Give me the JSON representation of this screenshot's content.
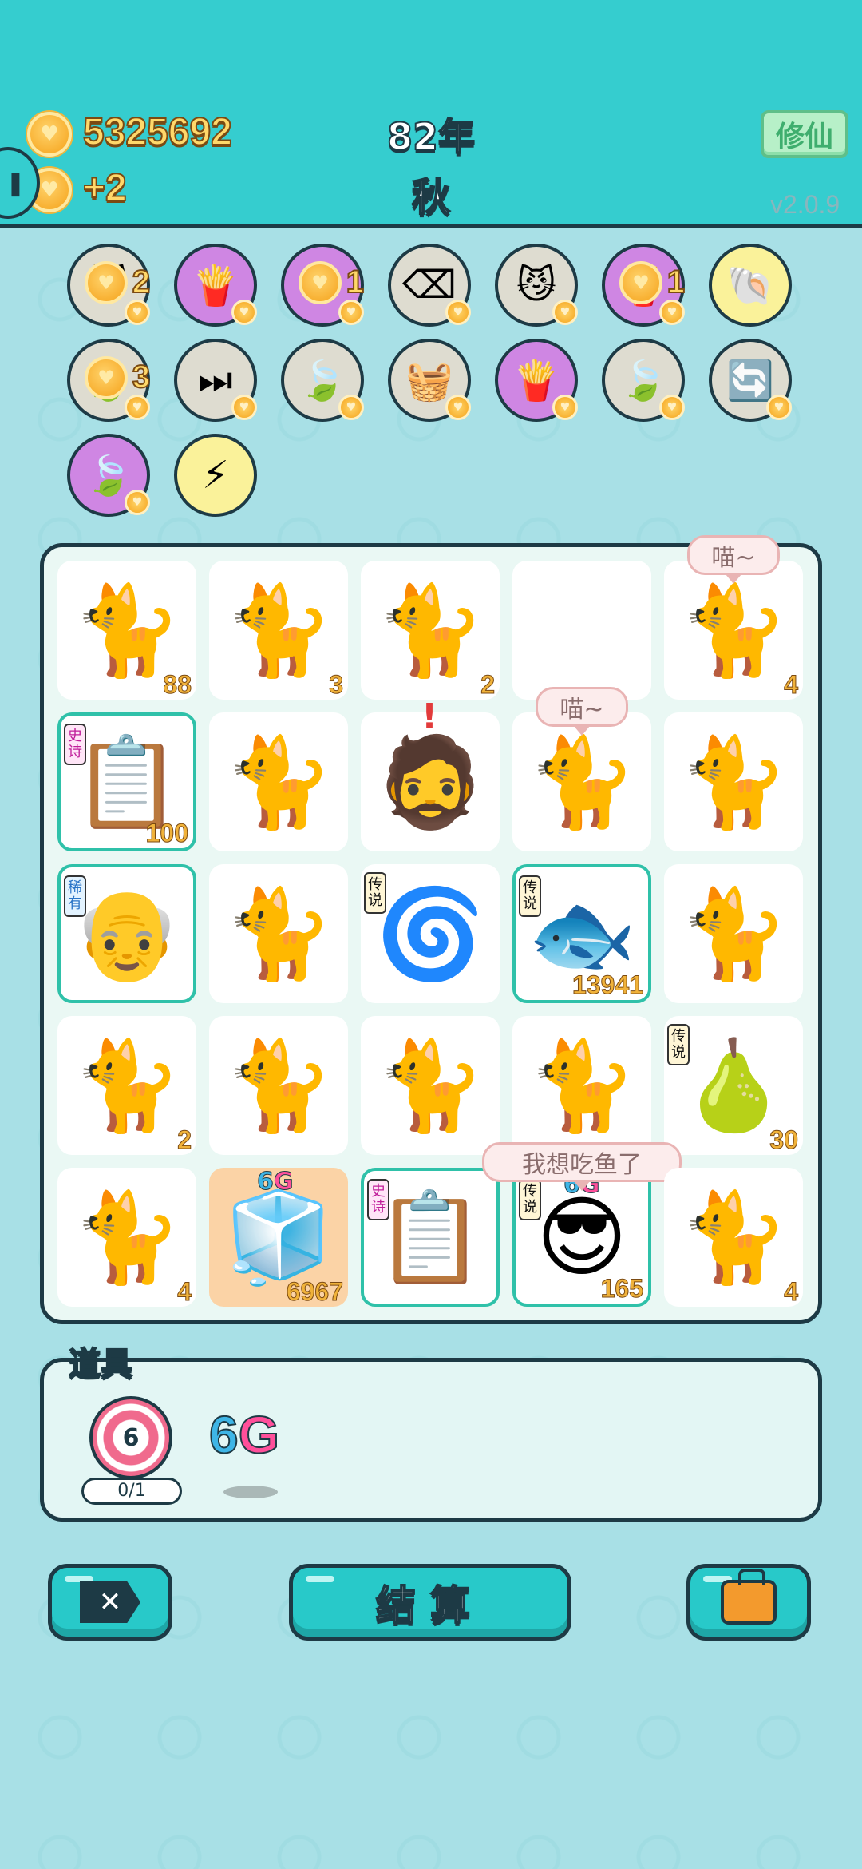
{
  "header": {
    "coins": "5325692",
    "coin_rate": "+2",
    "year": "82年",
    "season": "秋",
    "mode_button": "修仙",
    "version": "v2.0.9"
  },
  "items_row1": [
    {
      "name": "cat-item",
      "icon": "🐱",
      "count": "2",
      "color": "grey"
    },
    {
      "name": "fries-item",
      "icon": "🍟",
      "color": "purple"
    },
    {
      "name": "recycle-item",
      "icon": "♻",
      "count": "1",
      "color": "purple"
    },
    {
      "name": "delete-item",
      "icon": "⌫",
      "color": "grey"
    },
    {
      "name": "cat-eyes-item",
      "icon": "😼",
      "color": "grey"
    },
    {
      "name": "fries-item-2",
      "icon": "🍟",
      "count": "1",
      "color": "purple"
    },
    {
      "name": "shell-item",
      "icon": "🐚",
      "color": "yellow"
    }
  ],
  "items_row2": [
    {
      "name": "leaf-item",
      "icon": "🍃",
      "count": "3",
      "color": "grey"
    },
    {
      "name": "skip-item",
      "icon": "⏭",
      "color": "grey"
    },
    {
      "name": "leaf-item-2",
      "icon": "🍃",
      "color": "grey"
    },
    {
      "name": "basket-item",
      "icon": "🧺",
      "color": "grey"
    },
    {
      "name": "fries-item-3",
      "icon": "🍟",
      "color": "purple"
    },
    {
      "name": "leaf-item-3",
      "icon": "🍃",
      "color": "grey"
    },
    {
      "name": "refresh-item",
      "icon": "🔄",
      "color": "grey"
    }
  ],
  "items_row3": [
    {
      "name": "leaf-item-4",
      "icon": "🍃",
      "color": "purple"
    },
    {
      "name": "lightning-item",
      "icon": "⚡",
      "color": "yellow"
    }
  ],
  "board": [
    [
      {
        "icon": "🐈",
        "num": "88"
      },
      {
        "icon": "🐈",
        "num": "3"
      },
      {
        "icon": "🐈",
        "num": "2"
      },
      {
        "icon": "",
        "num": ""
      },
      {
        "icon": "🐈",
        "num": "4",
        "bubble": "喵~"
      }
    ],
    [
      {
        "icon": "📋",
        "num": "100",
        "tag": "史诗",
        "tagtype": "epic",
        "rare": true
      },
      {
        "icon": "🐈",
        "num": ""
      },
      {
        "icon": "🧔",
        "num": "",
        "exclaim": "!"
      },
      {
        "icon": "🐈",
        "num": "",
        "bubble": "喵~"
      },
      {
        "icon": "🐈",
        "num": ""
      }
    ],
    [
      {
        "icon": "👴",
        "num": "",
        "tag": "稀有",
        "tagtype": "rarebl",
        "rare": true
      },
      {
        "icon": "🐈",
        "num": ""
      },
      {
        "icon": "🌀",
        "num": "",
        "tag": "传说"
      },
      {
        "icon": "🐟",
        "num": "13941",
        "tag": "传说",
        "rare": true
      },
      {
        "icon": "🐈",
        "num": ""
      }
    ],
    [
      {
        "icon": "🐈",
        "num": "2"
      },
      {
        "icon": "🐈",
        "num": ""
      },
      {
        "icon": "🐈",
        "num": ""
      },
      {
        "icon": "🐈",
        "num": ""
      },
      {
        "icon": "🍐",
        "num": "30",
        "tag": "传说"
      }
    ],
    [
      {
        "icon": "🐈",
        "num": "4"
      },
      {
        "icon": "🧊",
        "num": "6967",
        "g6": true,
        "orange": true
      },
      {
        "icon": "📋",
        "num": "",
        "tag": "史诗",
        "tagtype": "epic",
        "rare": true
      },
      {
        "icon": "😎",
        "num": "165",
        "tag": "传说",
        "g6": true,
        "rare": true,
        "bubble": "我想吃鱼了"
      },
      {
        "icon": "🐈",
        "num": "4"
      }
    ]
  ],
  "props": {
    "label": "道具",
    "target_value": "6",
    "target_progress": "0/1",
    "g6_prefix": "6",
    "g6_suffix": "G"
  },
  "buttons": {
    "close_glyph": "✕",
    "settle": "结算",
    "bag_icon": "briefcase-icon"
  },
  "tag_6g": {
    "prefix": "6",
    "suffix": "G"
  }
}
